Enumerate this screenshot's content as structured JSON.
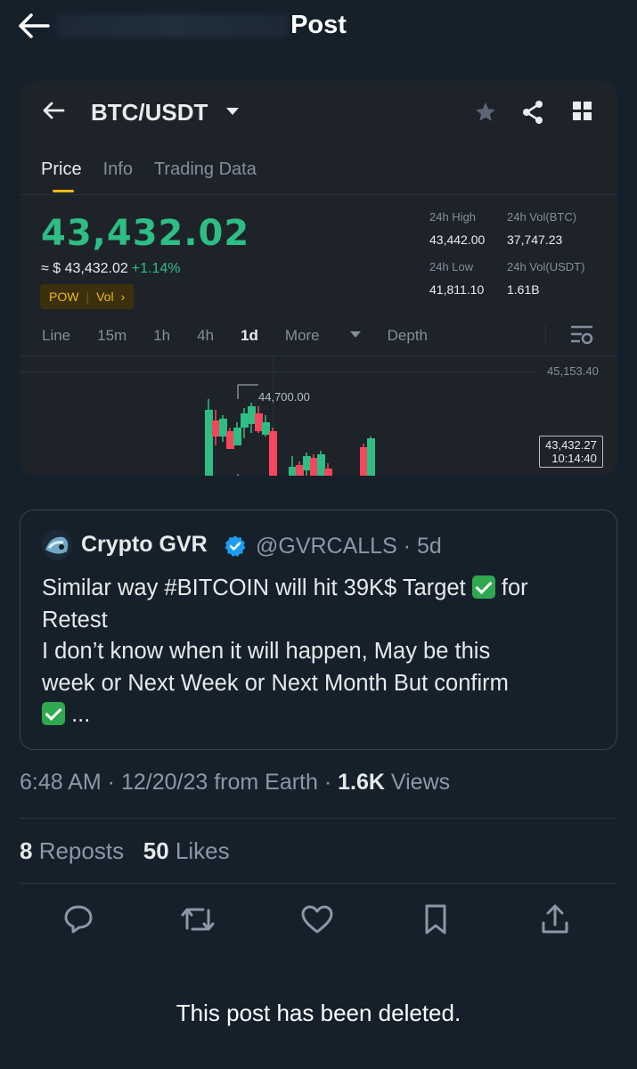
{
  "header": {
    "title": "Post"
  },
  "card": {
    "pair": "BTC/USDT",
    "tabs": [
      "Price",
      "Info",
      "Trading Data"
    ],
    "price": "43,432.02",
    "usd_price": "≈ $ 43,432.02",
    "change": "+1.14%",
    "badge": {
      "left": "POW",
      "right": "Vol"
    },
    "stats": {
      "high_label": "24h High",
      "high_value": "43,442.00",
      "volbtc_label": "24h Vol(BTC)",
      "volbtc_value": "37,747.23",
      "low_label": "24h Low",
      "low_value": "41,811.10",
      "volusdt_label": "24h Vol(USDT)",
      "volusdt_value": "1.61B"
    },
    "intervals": [
      "Line",
      "15m",
      "1h",
      "4h",
      "1d",
      "More",
      "Depth"
    ],
    "axis_top": "45,153.40",
    "high_marker": "44,700.00",
    "last_price": "43,432.27",
    "last_time": "10:14:40",
    "colors": {
      "up": "#2ebd85",
      "down": "#f6465d",
      "accent": "#f0b90b"
    }
  },
  "quote": {
    "name": "Crypto GVR",
    "handle": "@GVRCALLS",
    "age": "5d",
    "line1": "Similar way #BITCOIN will hit 39K$ Target",
    "line1_end": "for",
    "line2": "Retest",
    "line3": "I don’t know when it will happen, May be this",
    "line4": "week or Next Week or Next Month But confirm",
    "line5_end": "..."
  },
  "meta": {
    "time": "6:48 AM · 12/20/23 from Earth · ",
    "views_count": "1.6K",
    "views_label": " Views"
  },
  "stats": {
    "reposts_count": "8",
    "reposts_label": " Reposts",
    "likes_count": "50",
    "likes_label": " Likes"
  },
  "footer": {
    "deleted": "This post has been deleted."
  }
}
